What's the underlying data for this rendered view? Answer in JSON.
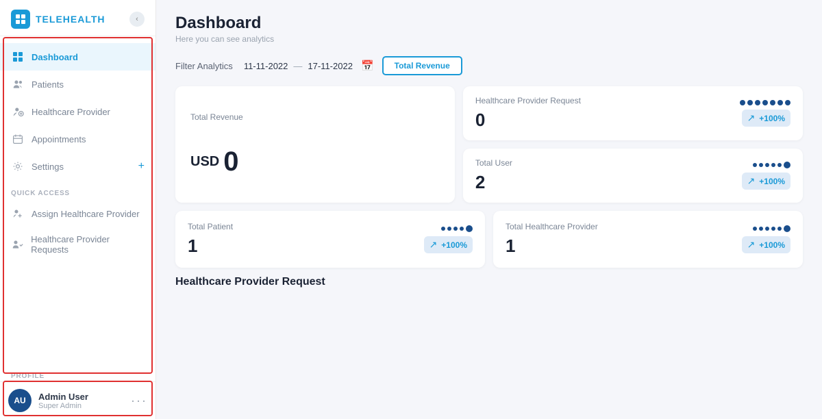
{
  "app": {
    "name": "TELEHEALTH"
  },
  "sidebar": {
    "nav_items": [
      {
        "id": "dashboard",
        "label": "Dashboard",
        "icon": "grid",
        "active": true
      },
      {
        "id": "patients",
        "label": "Patients",
        "icon": "users"
      },
      {
        "id": "healthcare-provider",
        "label": "Healthcare Provider",
        "icon": "doctor"
      },
      {
        "id": "appointments",
        "label": "Appointments",
        "icon": "calendar"
      },
      {
        "id": "settings",
        "label": "Settings",
        "icon": "gear",
        "has_plus": true
      }
    ],
    "quick_access_label": "QUICK ACCESS",
    "quick_access_items": [
      {
        "id": "assign-provider",
        "label": "Assign Healthcare Provider",
        "icon": "assign"
      },
      {
        "id": "provider-requests",
        "label": "Healthcare Provider Requests",
        "icon": "requests"
      }
    ],
    "profile_label": "PROFILE",
    "profile": {
      "initials": "AU",
      "name": "Admin User",
      "role": "Super Admin"
    }
  },
  "dashboard": {
    "title": "Dashboard",
    "subtitle": "Here you can see analytics",
    "filter": {
      "label": "Filter Analytics",
      "date_from": "11-11-2022",
      "date_to": "17-11-2022",
      "button_label": "Total Revenue"
    },
    "stats": {
      "revenue": {
        "label": "Total Revenue",
        "prefix": "USD",
        "value": "0"
      },
      "provider_request": {
        "label": "Healthcare Provider Request",
        "value": "0",
        "trend": "+100%"
      },
      "total_user": {
        "label": "Total User",
        "value": "2",
        "trend": "+100%"
      },
      "total_patient": {
        "label": "Total Patient",
        "value": "1",
        "trend": "+100%"
      },
      "total_healthcare_provider": {
        "label": "Total Healthcare Provider",
        "value": "1",
        "trend": "+100%"
      }
    },
    "bottom_section_title": "Healthcare Provider Request"
  }
}
